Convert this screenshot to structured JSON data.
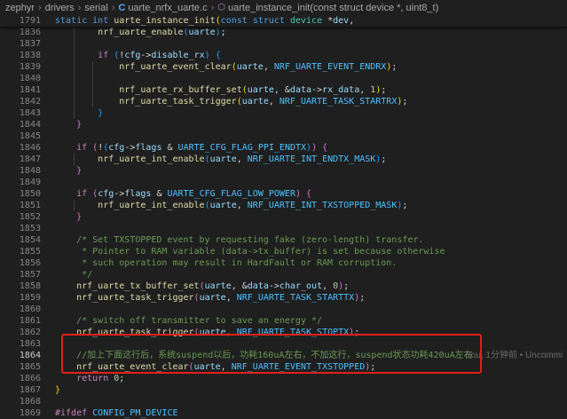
{
  "breadcrumb": {
    "items": [
      "zephyr",
      "drivers",
      "serial",
      "uarte_nrfx_uarte.c",
      "uarte_instance_init(const struct device *, uint8_t)"
    ]
  },
  "gutter": {
    "numbers": [
      "1791",
      "1836",
      "1837",
      "1838",
      "1839",
      "1840",
      "1841",
      "1842",
      "1843",
      "1844",
      "1845",
      "1846",
      "1847",
      "1848",
      "1849",
      "1850",
      "1851",
      "1852",
      "1853",
      "1854",
      "1855",
      "1856",
      "1857",
      "1858",
      "1859",
      "1860",
      "1861",
      "1862",
      "1863",
      "1864",
      "1865",
      "1866",
      "1867",
      "1868",
      "1869"
    ]
  },
  "blame": "You, 1分钟前 • Uncommi",
  "icons": {
    "file": "c-file-icon",
    "symbol": "method-cube-icon",
    "chevron": "chevron-right-icon"
  }
}
